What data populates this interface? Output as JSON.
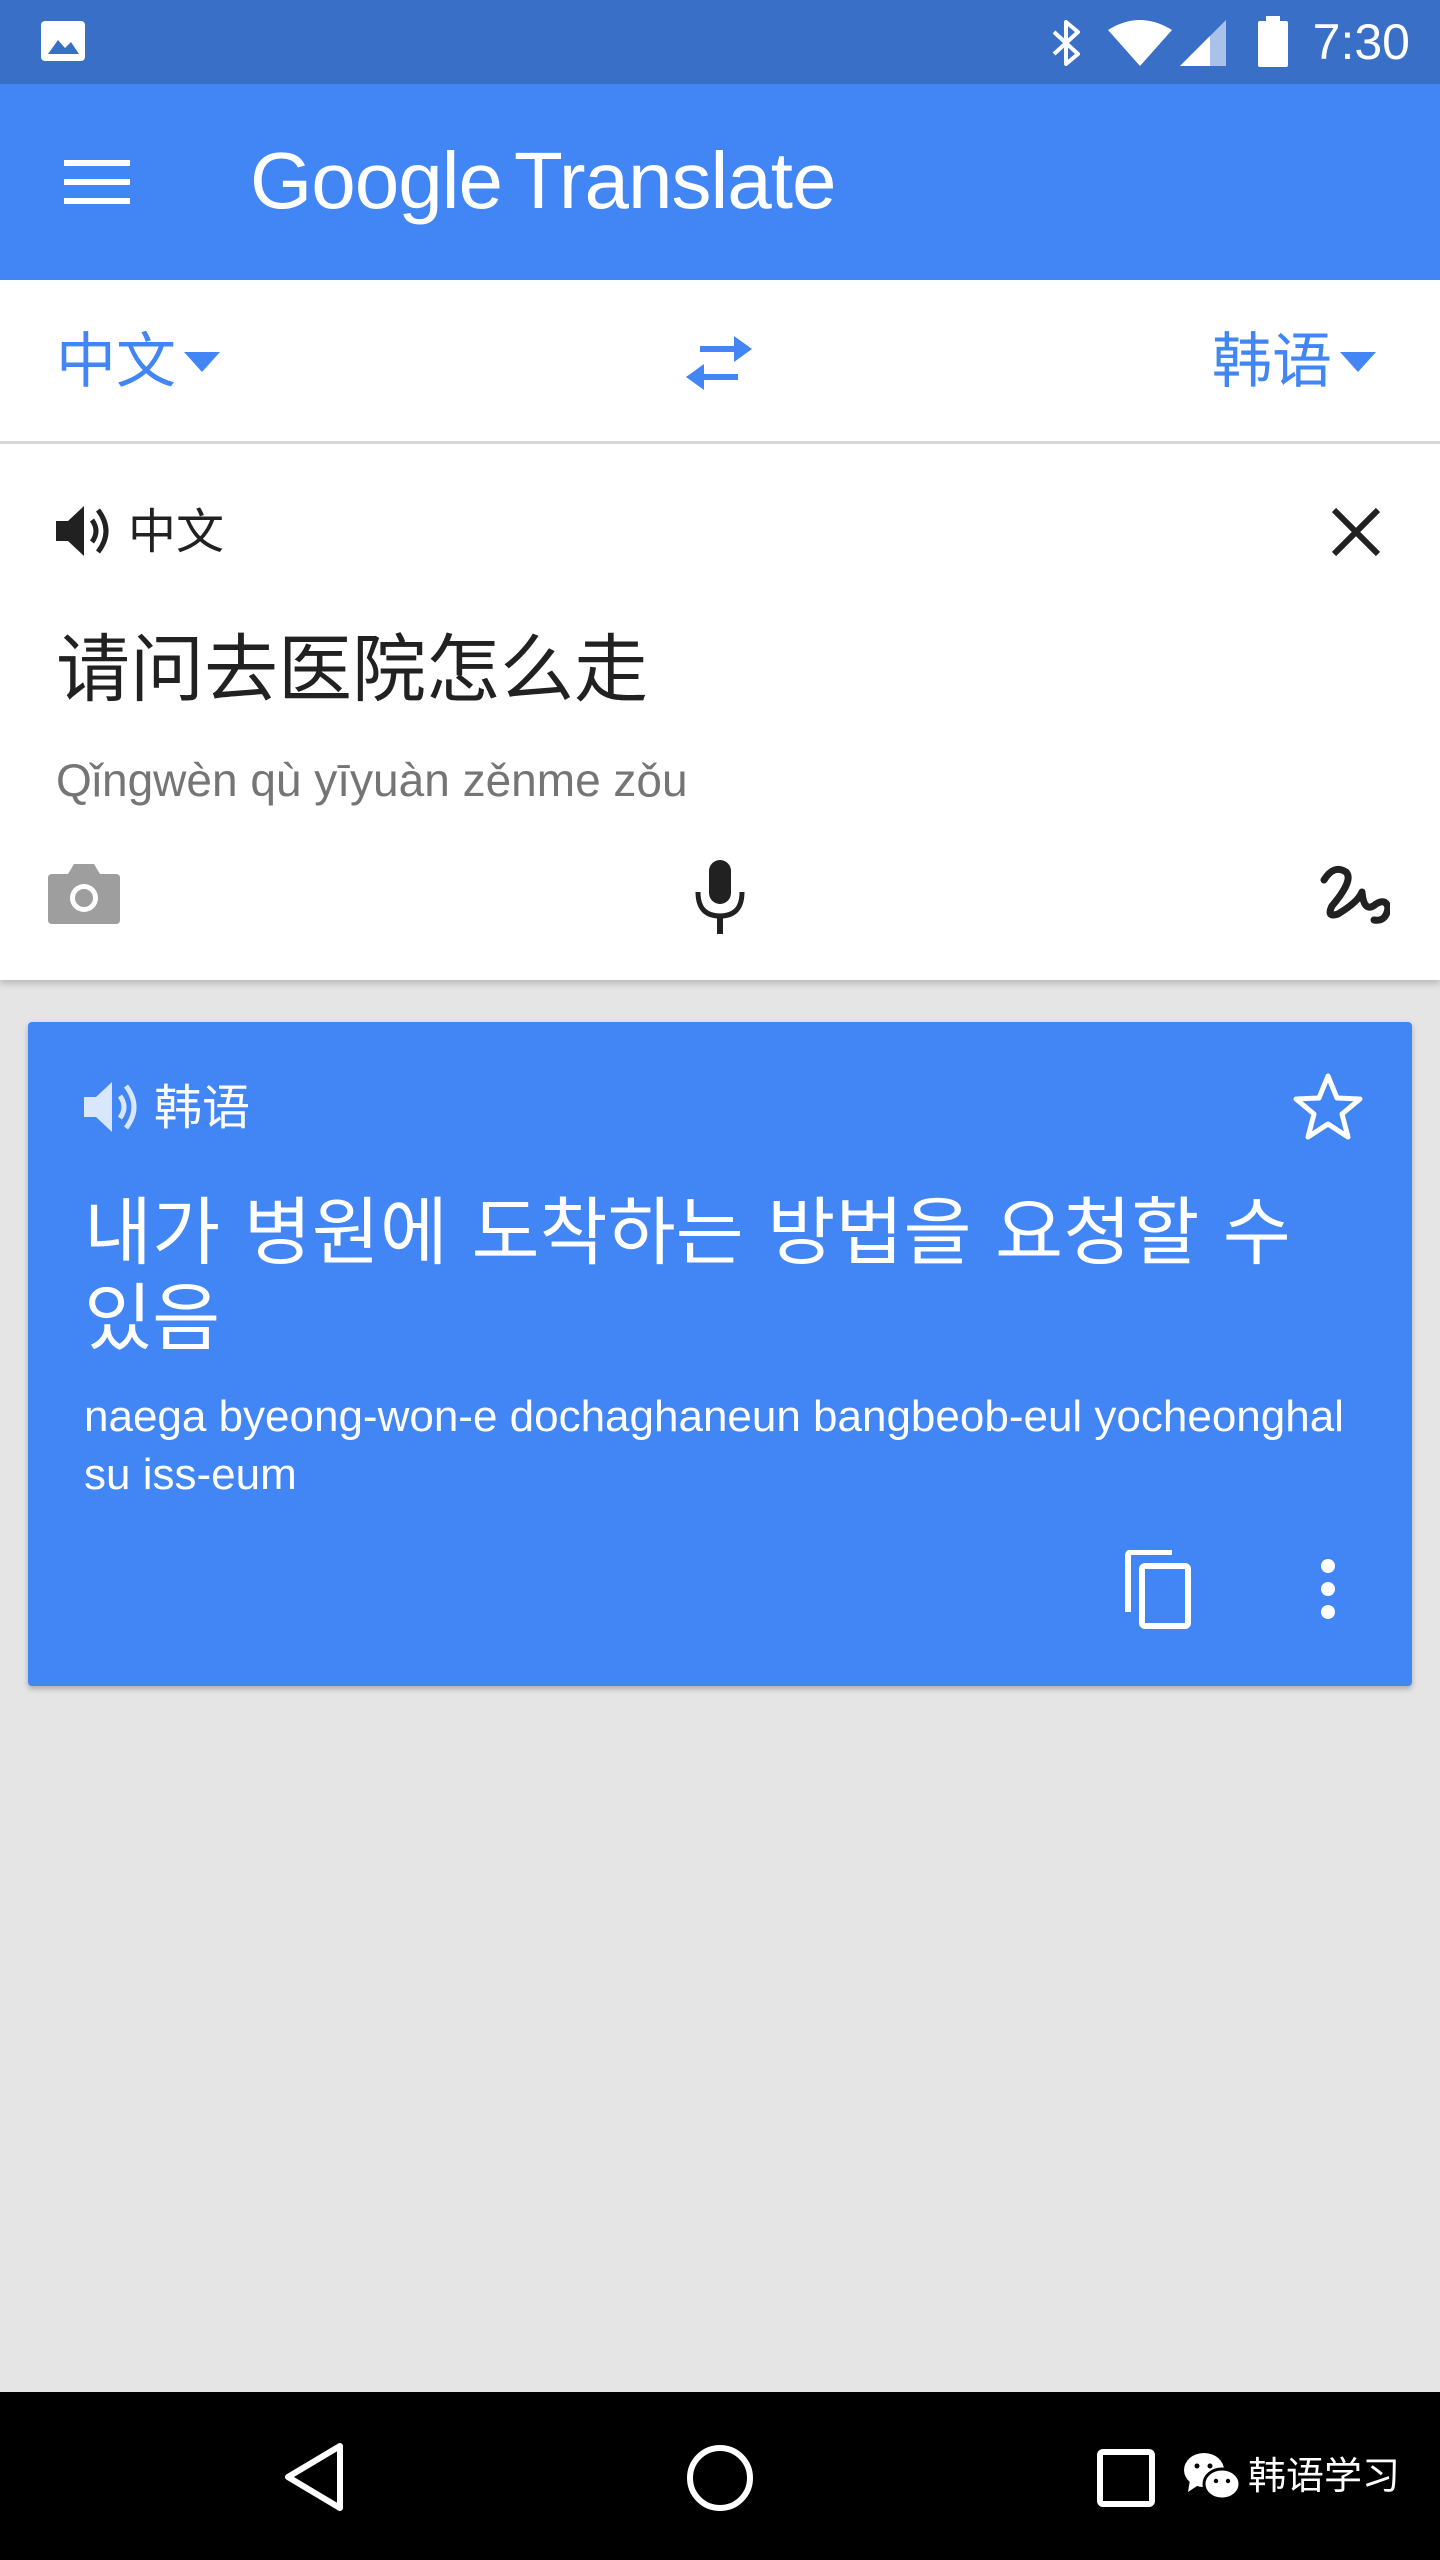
{
  "status_bar": {
    "time": "7:30",
    "icons": [
      "image-notification-icon",
      "bluetooth-icon",
      "wifi-icon",
      "cell-signal-icon",
      "battery-icon"
    ]
  },
  "app_bar": {
    "title_brand": "Google",
    "title_product": "Translate",
    "menu_icon": "hamburger-menu-icon"
  },
  "language_bar": {
    "source_language": "中文",
    "target_language": "韩语",
    "swap_icon": "swap-arrows-icon"
  },
  "input": {
    "language_label": "中文",
    "text": "请问去医院怎么走",
    "transliteration": "Qǐngwèn qù yīyuàn zěnme zǒu",
    "tools": [
      "camera-icon",
      "microphone-icon",
      "handwriting-icon"
    ]
  },
  "result": {
    "language_label": "韩语",
    "text": "내가 병원에 도착하는 방법을 요청할 수 있음",
    "transliteration": "naega byeong-won-e dochaghaneun bangbeob-eul yocheonghal su iss-eum",
    "actions": [
      "star-icon",
      "copy-icon",
      "more-vert-icon"
    ]
  },
  "nav_bar": {
    "buttons": [
      "back-icon",
      "home-icon",
      "recents-icon"
    ]
  },
  "watermark": {
    "text": "韩语学习"
  },
  "colors": {
    "status_bar": "#3a6fc8",
    "brand_blue": "#4285f4",
    "background": "#e5e5e5",
    "text_dark": "#212121",
    "text_muted": "#757575"
  }
}
